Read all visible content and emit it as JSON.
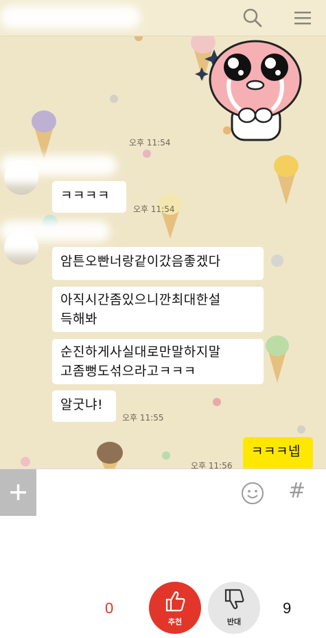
{
  "messages": [
    {
      "text": "ㅋㅋㅋㅋ",
      "time": "오후 11:54"
    },
    {
      "text": "암튼오빤너랑같이갔음좋겠다"
    },
    {
      "text_lines": [
        "아직시간좀있으니깐최대한설",
        "득해봐"
      ]
    },
    {
      "text_lines": [
        "순진하게사실대로만말하지말",
        "고좀뻥도섞으라고ㅋㅋㅋ"
      ]
    },
    {
      "text": "알굿냐!",
      "time": "오후 11:55"
    }
  ],
  "my_message": {
    "text": "ㅋㅋㅋ넵",
    "time": "오후 11:56"
  },
  "sticker_time": "오후 11:54",
  "votes": {
    "up_label": "추천",
    "up_count": "0",
    "down_label": "반대",
    "down_count": "9"
  },
  "colors": {
    "wallpaper": "#efe6c8",
    "my_bubble": "#ffe800",
    "vote_up": "#e2362a"
  },
  "icons": [
    "search-icon",
    "menu-icon",
    "plus-icon",
    "emoji-icon",
    "hash-icon",
    "thumbs-up-icon",
    "thumbs-down-icon"
  ]
}
